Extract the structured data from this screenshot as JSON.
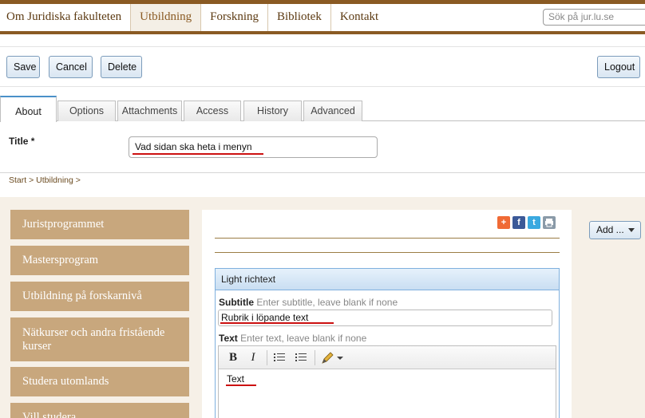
{
  "topnav": {
    "items": [
      "Om Juridiska fakulteten",
      "Utbildning",
      "Forskning",
      "Bibliotek",
      "Kontakt"
    ],
    "active_index": 1,
    "search_placeholder": "Sök på jur.lu.se"
  },
  "toolbar": {
    "save": "Save",
    "cancel": "Cancel",
    "delete": "Delete",
    "logout": "Logout"
  },
  "tabs": [
    "About",
    "Options",
    "Attachments",
    "Access",
    "History",
    "Advanced"
  ],
  "active_tab": "About",
  "title_field": {
    "label": "Title *",
    "value": "Vad sidan ska heta i menyn"
  },
  "breadcrumb": "Start > Utbildning >",
  "sidenav": {
    "items": [
      "Juristprogrammet",
      "Mastersprogram",
      "Utbildning på forskarnivå",
      "Nätkurser och andra fristående kurser",
      "Studera utomlands",
      "Vill studera"
    ]
  },
  "share_icons": [
    "plus-share-icon",
    "facebook-icon",
    "twitter-icon",
    "print-icon"
  ],
  "add_button": "Add ...",
  "richtext": {
    "header": "Light richtext",
    "subtitle_label": "Subtitle",
    "subtitle_hint": "Enter subtitle, leave blank if none",
    "subtitle_value": "Rubrik i löpande text",
    "text_label": "Text",
    "text_hint": "Enter text, leave blank if none",
    "text_value": "Text",
    "toolbar": {
      "bold": "B",
      "italic": "I"
    }
  },
  "colors": {
    "brand_brown": "#8a5a23",
    "sidenav_tan": "#c8a77d",
    "button_border": "#7c9cbb",
    "annotation_red": "#cc1111"
  }
}
